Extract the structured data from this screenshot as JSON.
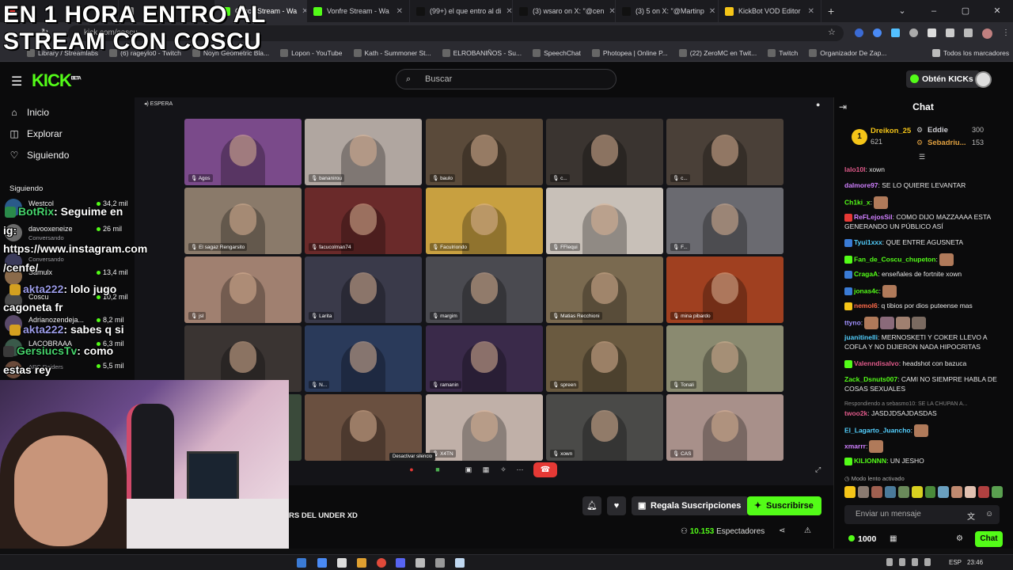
{
  "caption": {
    "line1": "EN 1 HORA ENTRO AL",
    "line2": "STREAM CON COSCU"
  },
  "browser": {
    "tabs": [
      {
        "label": "",
        "color": "#e53935"
      },
      {
        "label": "Coscu Stream - Wa",
        "color": "#53fc18",
        "active": true
      },
      {
        "label": "Vonfre Stream - Wa",
        "color": "#53fc18"
      },
      {
        "label": "(99+) el que entro al di",
        "color": "#111111"
      },
      {
        "label": "(3) wsaro on X: \"@cen",
        "color": "#111111"
      },
      {
        "label": "(3) 5 on X: \"@Martinp",
        "color": "#111111"
      },
      {
        "label": "KickBot VOD Editor",
        "color": "#f5c518"
      }
    ],
    "url": "kick.com/coscu",
    "bookmarks": [
      "Library / Streamlabs",
      "(6) rageylo0 - Twitch",
      "Noyn Geometric Bla...",
      "Lopon - YouTube",
      "Kath - Summoner St...",
      "ELROBANIÑOS - Su...",
      "SpeechChat",
      "Photopea | Online P...",
      "(22) ZeroMC en Twit...",
      "Twitch",
      "Organizador De Zap..."
    ],
    "bookmarks_right": "Todos los marcadores"
  },
  "kick": {
    "logo": "KICK",
    "logo_sup": "BETA",
    "search_placeholder": "Buscar",
    "get_kicks": "Obtén KICKs"
  },
  "nav": {
    "items": [
      {
        "label": "Inicio",
        "icon": "home-icon",
        "glyph": "⌂"
      },
      {
        "label": "Explorar",
        "icon": "compass-icon",
        "glyph": "◫"
      },
      {
        "label": "Siguiendo",
        "icon": "heart-icon",
        "glyph": "♡"
      }
    ],
    "following_title": "Siguiendo",
    "following": [
      {
        "name": "Westcol",
        "viewers": "34,2 mil",
        "sub": ""
      },
      {
        "name": "davooxeneize",
        "viewers": "26 mil",
        "sub": "Conversando"
      },
      {
        "name": "",
        "viewers": "",
        "sub": "Conversando"
      },
      {
        "name": "Samulx",
        "viewers": "13,4 mil",
        "sub": ""
      },
      {
        "name": "Coscu",
        "viewers": "10,2 mil",
        "sub": ""
      },
      {
        "name": "Adrianozendeja...",
        "viewers": "8,2 mil",
        "sub": ""
      },
      {
        "name": "LACOBRAAA",
        "viewers": "6,3 mil",
        "sub": ""
      },
      {
        "name": "",
        "viewers": "5,5 mil",
        "sub": "ARC Raiders"
      }
    ]
  },
  "overlay_chat": [
    {
      "user": "BotRix",
      "text": ": Seguime en"
    },
    {
      "user": "",
      "text": "ig:"
    },
    {
      "user": "",
      "text": "https://www.instagram.com"
    },
    {
      "user": "",
      "text": "/cenfe/"
    },
    {
      "user": "akta222",
      "text": ": lolo jugo"
    },
    {
      "user": "",
      "text": "cagoneta fr"
    },
    {
      "user": "akta222",
      "text": ": sabes q si"
    },
    {
      "user": "GersiucsTv",
      "text": ": como"
    },
    {
      "user": "",
      "text": "estas rey"
    }
  ],
  "video": {
    "status": "ESPERA",
    "tooltip": "Desactivar silencio",
    "participants": [
      {
        "name": "Agos",
        "bg": "#7a4a8a"
      },
      {
        "name": "bananirou",
        "bg": "#b0a6a0"
      },
      {
        "name": "baulo",
        "bg": "#5a4a3a"
      },
      {
        "name": "c...",
        "bg": "#3a3430"
      },
      {
        "name": "c...",
        "bg": "#4a4038"
      },
      {
        "name": "El sagaz Rengarsito",
        "bg": "#8a7a6a"
      },
      {
        "name": "facucolman74",
        "bg": "#6a2a2a"
      },
      {
        "name": "Faculriondo",
        "bg": "#c8a040"
      },
      {
        "name": "FFlequi",
        "bg": "#c8c0b8"
      },
      {
        "name": "F...",
        "bg": "#6a6a70"
      },
      {
        "name": "jsl",
        "bg": "#a08070"
      },
      {
        "name": "Larita",
        "bg": "#3a3a4a"
      },
      {
        "name": "margim",
        "bg": "#4a4a50"
      },
      {
        "name": "Matias Recchioni",
        "bg": "#7a6a50"
      },
      {
        "name": "mina pibardo",
        "bg": "#a04020"
      },
      {
        "name": "",
        "bg": "#3a3432"
      },
      {
        "name": "N...",
        "bg": "#2a3a5a"
      },
      {
        "name": "ramanin",
        "bg": "#3a2a4a"
      },
      {
        "name": "spreen",
        "bg": "#6a5a40"
      },
      {
        "name": "Tonali",
        "bg": "#8a8a70"
      },
      {
        "name": "T...",
        "bg": "#3a4a3a"
      },
      {
        "name": "",
        "bg": "#6a5040"
      },
      {
        "name": "X4TN",
        "bg": "#c0b0a8"
      },
      {
        "name": "xown",
        "bg": "#4a4a48"
      },
      {
        "name": "CAS",
        "bg": "#a8908a"
      }
    ]
  },
  "below": {
    "title": "RS DEL UNDER XD",
    "gift": "Regala Suscripciones",
    "subscribe": "Suscribirse",
    "viewers": "10.153",
    "viewers_label": "Espectadores"
  },
  "chat": {
    "title": "Chat",
    "leaderboard": [
      {
        "name": "Dreikon_25",
        "value": "621"
      },
      {
        "name": "Eddie",
        "value": "300"
      },
      {
        "name": "Sebadriu...",
        "value": "153"
      }
    ],
    "messages": [
      {
        "user": "lalo10l",
        "color": "#e05a8a",
        "text": ": xown"
      },
      {
        "user": "dalmore97",
        "color": "#d080ff",
        "text": ": SE LO QUIERE LEVANTAR"
      },
      {
        "user": "Ch1ki_x",
        "color": "#53fc18",
        "text": ":"
      },
      {
        "user": "ReFLejosSil",
        "color": "#d080ff",
        "text": ": COMO DIJO MAZZAAAA ESTA GENERANDO UN PÚBLICO ASÍ"
      },
      {
        "user": "Tyui1xxx",
        "color": "#53d0ff",
        "text": ": QUE ENTRE AGUSNETA"
      },
      {
        "user": "Fan_de_Coscu_chupeton",
        "color": "#53fc18",
        "text": ":"
      },
      {
        "user": "CragaA",
        "color": "#53fc18",
        "text": ": enseñales de fortnite xown"
      },
      {
        "user": "jonas4c",
        "color": "#53fc18",
        "text": ":"
      },
      {
        "user": "nemol6",
        "color": "#ff6b4a",
        "text": ": q tibios por dios puteense mas"
      },
      {
        "user": "ttyno",
        "color": "#a090ff",
        "text": ":"
      },
      {
        "user": "juanitinelli",
        "color": "#53d0ff",
        "text": ": MERNOSKETI Y COKER LLEVO A COFLA Y NO DIJIERON NADA HIPOCRITAS"
      },
      {
        "user": "Valenndisalvo",
        "color": "#e05a8a",
        "text": ": headshot con bazuca"
      },
      {
        "user": "Zack_Dsnuts007",
        "color": "#53fc18",
        "text": ": CAMI NO SIEMPRE HABLA DE COSAS SEXUALES"
      },
      {
        "user": "",
        "color": "#888888",
        "text": "Respondiendo a sebasmo10: SE LA CHUPAN A..."
      },
      {
        "user": "twoo2k",
        "color": "#e05a8a",
        "text": ": JASDJDSAJDASDAS"
      },
      {
        "user": "El_Lagarto_Juancho",
        "color": "#53d0ff",
        "text": ":"
      },
      {
        "user": "xmarrr",
        "color": "#d080ff",
        "text": ":"
      },
      {
        "user": "KILIONNN",
        "color": "#53fc18",
        "text": ": UN JESHO"
      }
    ],
    "slow_mode": "Modo lento activado",
    "input_placeholder": "Enviar un mensaje",
    "points": "1000",
    "send_button": "Chat"
  },
  "taskbar": {
    "lang": "ESP",
    "time": "23:46"
  }
}
